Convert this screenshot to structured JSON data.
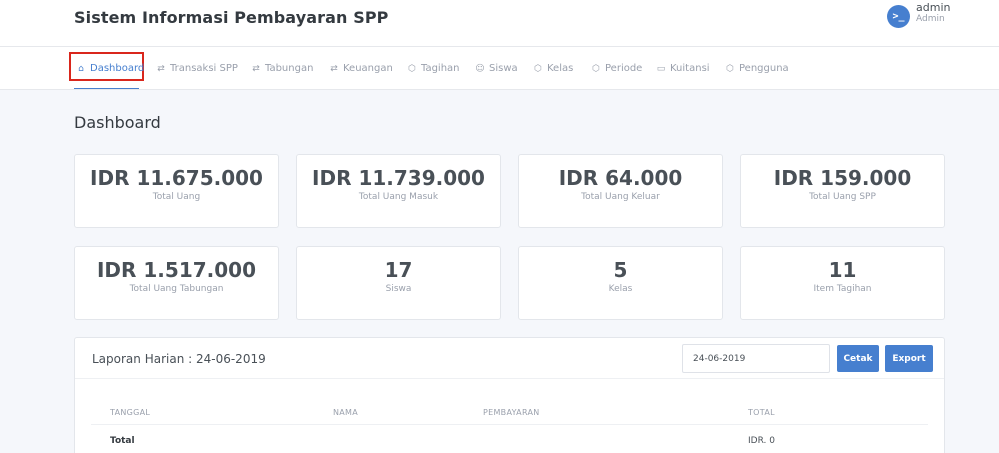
{
  "app": {
    "title": "Sistem Informasi Pembayaran SPP"
  },
  "user": {
    "name": "admin",
    "role": "Admin",
    "icon": "terminal-icon",
    "icon_glyph": ">_"
  },
  "nav": {
    "items": [
      {
        "label": "Dashboard",
        "icon": "home-icon",
        "glyph": "⌂",
        "active": true
      },
      {
        "label": "Transaksi SPP",
        "icon": "repeat-icon",
        "glyph": "⇄"
      },
      {
        "label": "Tabungan",
        "icon": "repeat-icon",
        "glyph": "⇄"
      },
      {
        "label": "Keuangan",
        "icon": "repeat-icon",
        "glyph": "⇄"
      },
      {
        "label": "Tagihan",
        "icon": "box-icon",
        "glyph": "⬡"
      },
      {
        "label": "Siswa",
        "icon": "users-icon",
        "glyph": "☺"
      },
      {
        "label": "Kelas",
        "icon": "box-icon",
        "glyph": "⬡"
      },
      {
        "label": "Periode",
        "icon": "box-icon",
        "glyph": "⬡"
      },
      {
        "label": "Kuitansi",
        "icon": "folder-icon",
        "glyph": "▭"
      },
      {
        "label": "Pengguna",
        "icon": "box-icon",
        "glyph": "⬡"
      }
    ]
  },
  "page": {
    "title": "Dashboard"
  },
  "stats": [
    {
      "value": "IDR 11.675.000",
      "label": "Total Uang"
    },
    {
      "value": "IDR 11.739.000",
      "label": "Total Uang Masuk"
    },
    {
      "value": "IDR 64.000",
      "label": "Total Uang Keluar"
    },
    {
      "value": "IDR 159.000",
      "label": "Total Uang SPP"
    },
    {
      "value": "IDR 1.517.000",
      "label": "Total Uang Tabungan"
    },
    {
      "value": "17",
      "label": "Siswa"
    },
    {
      "value": "5",
      "label": "Kelas"
    },
    {
      "value": "11",
      "label": "Item Tagihan"
    }
  ],
  "report": {
    "title": "Laporan Harian : 24-06-2019",
    "date_value": "24-06-2019",
    "cetak_label": "Cetak",
    "export_label": "Export",
    "columns": [
      "TANGGAL",
      "NAMA",
      "PEMBAYARAN",
      "TOTAL"
    ],
    "total_label": "Total",
    "total_value": "IDR. 0"
  },
  "colors": {
    "accent": "#467fcf",
    "highlight": "#d9261c",
    "background": "#f5f7fb"
  }
}
